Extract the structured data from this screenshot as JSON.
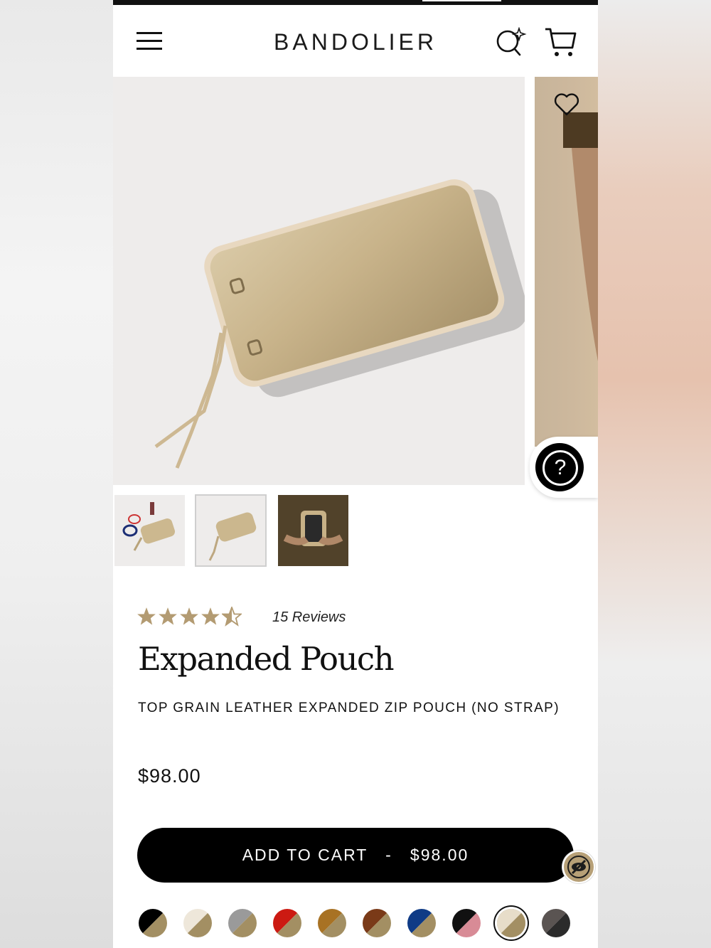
{
  "header": {
    "logo": "BANDOLIER",
    "menu_icon": "hamburger-menu-icon",
    "search_icon": "search-sparkle-icon",
    "cart_icon": "cart-icon"
  },
  "gallery": {
    "favorite_icon": "heart-icon",
    "chat_icon": "help-chat-icon",
    "thumbnails": [
      "thumbnail-pouch-contents",
      "thumbnail-pouch-gold",
      "thumbnail-pouch-worn"
    ],
    "selected_thumbnail": 2
  },
  "product": {
    "rating": 4.5,
    "rating_max": 5,
    "reviews_label": "15 Reviews",
    "title": "Expanded Pouch",
    "subtitle": "TOP GRAIN LEATHER EXPANDED ZIP POUCH (NO STRAP)",
    "price": "$98.00",
    "add_to_cart_label": "ADD TO CART   -   $98.00",
    "visibility_icon": "eye-off-icon"
  },
  "colors": {
    "star": "#b39b72",
    "accent_gold": "#a38f63",
    "button": "#000000",
    "swatches": [
      {
        "a": "#000000",
        "b": "#a38f63"
      },
      {
        "a": "#eee7da",
        "b": "#a38f63"
      },
      {
        "a": "#9a9a9a",
        "b": "#a38f63"
      },
      {
        "a": "#cc1a12",
        "b": "#a38f63"
      },
      {
        "a": "#a87224",
        "b": "#a38f63"
      },
      {
        "a": "#7a3a18",
        "b": "#a38f63"
      },
      {
        "a": "#0f3b86",
        "b": "#a38f63"
      },
      {
        "a": "#111111",
        "b": "#d88b96"
      },
      {
        "a": "#e7ddc9",
        "b": "#a38f63",
        "selected": true
      },
      {
        "a": "#5a5452",
        "b": "#2b2b2b"
      }
    ]
  }
}
